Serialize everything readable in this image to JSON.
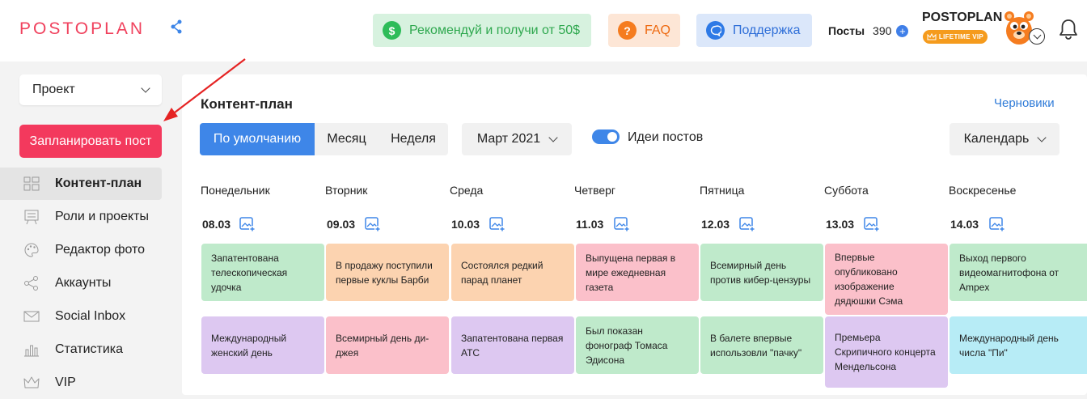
{
  "header": {
    "logo": "POSTOPLAN",
    "referral_label": "Рекомендуй и получи от 50$",
    "referral_icon": "$",
    "faq_label": "FAQ",
    "faq_icon": "?",
    "support_label": "Поддержка",
    "posts_label": "Посты",
    "posts_count": "390",
    "posts_add": "+",
    "account_name": "POSTOPLAN",
    "vip_badge": "LIFETIME VIP",
    "icons": [
      "share-icon",
      "dollar-icon",
      "question-icon",
      "chat-icon",
      "plus-icon",
      "crown-icon",
      "chevron-down-icon",
      "bell-icon"
    ]
  },
  "sidebar": {
    "project_label": "Проект",
    "plan_button": "Запланировать пост",
    "items": [
      {
        "label": "Контент-план",
        "icon": "grid-icon",
        "active": true
      },
      {
        "label": "Роли и проекты",
        "icon": "board-icon",
        "active": false
      },
      {
        "label": "Редактор фото",
        "icon": "palette-icon",
        "active": false
      },
      {
        "label": "Аккаунты",
        "icon": "share-icon",
        "active": false
      },
      {
        "label": "Social Inbox",
        "icon": "mail-icon",
        "active": false
      },
      {
        "label": "Статистика",
        "icon": "bar-chart-icon",
        "active": false
      },
      {
        "label": "VIP",
        "icon": "crown-icon",
        "active": false
      }
    ]
  },
  "main": {
    "title": "Контент-план",
    "drafts_link": "Черновики",
    "views": [
      "По умолчанию",
      "Месяц",
      "Неделя"
    ],
    "active_view": "По умолчанию",
    "month": "Март 2021",
    "ideas_label": "Идеи постов",
    "ideas_enabled": true,
    "calendar_select": "Календарь",
    "colors": {
      "accent": "#3e86e8",
      "brand": "#f3395d",
      "green": "#bfeacb",
      "orange": "#fcd3b0",
      "pink": "#fbc0ca",
      "purple": "#ddc8f1",
      "cyan": "#b7ecf6"
    },
    "days": [
      {
        "name": "Понедельник",
        "date": "08.03",
        "cards": [
          {
            "text": "Запатентована телескопическая удочка",
            "color": "green"
          },
          {
            "text": "Международный женский день",
            "color": "purple"
          }
        ]
      },
      {
        "name": "Вторник",
        "date": "09.03",
        "cards": [
          {
            "text": "В продажу поступили первые куклы Барби",
            "color": "orange"
          },
          {
            "text": "Всемирный день ди-джея",
            "color": "pink"
          }
        ]
      },
      {
        "name": "Среда",
        "date": "10.03",
        "cards": [
          {
            "text": "Состоялся редкий парад планет",
            "color": "orange"
          },
          {
            "text": "Запатентована первая АТС",
            "color": "purple"
          }
        ]
      },
      {
        "name": "Четверг",
        "date": "11.03",
        "cards": [
          {
            "text": "Выпущена первая в мире ежедневная газета",
            "color": "pink"
          },
          {
            "text": "Был показан фонограф Томаса Эдисона",
            "color": "green"
          }
        ]
      },
      {
        "name": "Пятница",
        "date": "12.03",
        "cards": [
          {
            "text": "Всемирный день против кибер-цензуры",
            "color": "green"
          },
          {
            "text": "В балете впервые использовли \"пачку\"",
            "color": "green"
          }
        ]
      },
      {
        "name": "Суббота",
        "date": "13.03",
        "cards": [
          {
            "text": "Впервые опубликовано изображение дядюшки Сэма",
            "color": "pink"
          },
          {
            "text": "Премьера Скрипичного концерта Мендельсона",
            "color": "purple"
          }
        ]
      },
      {
        "name": "Воскресенье",
        "date": "14.03",
        "cards": [
          {
            "text": "Выход первого видеомагнитофона от Ampex",
            "color": "green"
          },
          {
            "text": "Международный день числа \"Пи\"",
            "color": "cyan"
          }
        ]
      }
    ]
  }
}
